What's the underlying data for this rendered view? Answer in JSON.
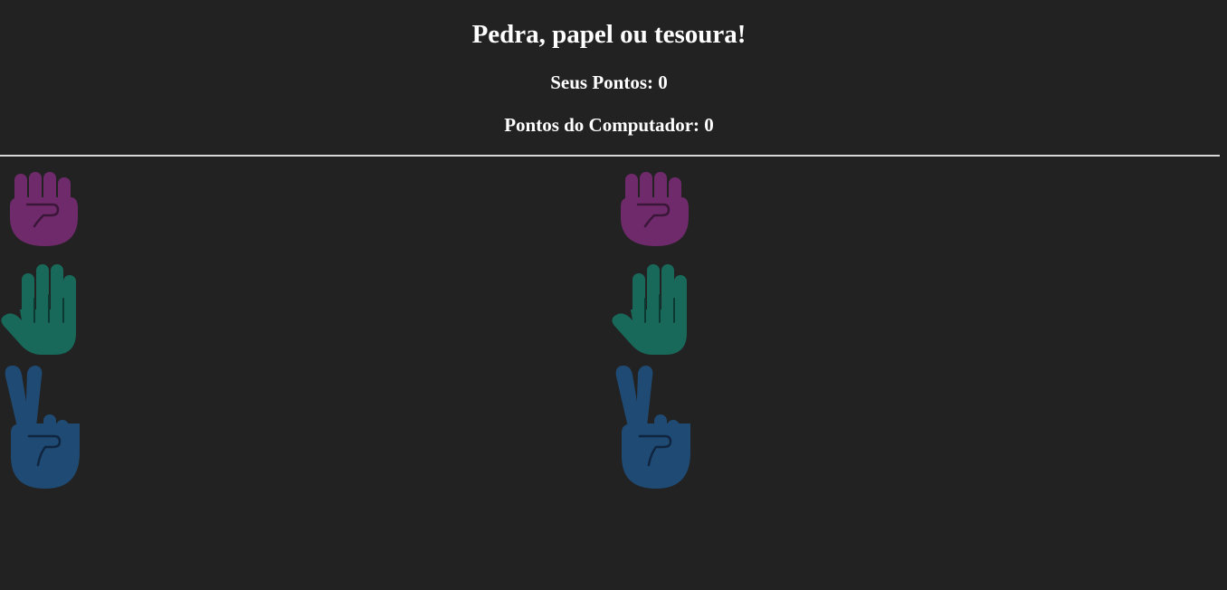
{
  "game": {
    "title": "Pedra, papel ou tesoura!",
    "player_score_label": "Seus Pontos: 0",
    "computer_score_label": "Pontos do Computador: 0"
  },
  "choices": [
    {
      "name": "rock",
      "icon": "fist-icon",
      "color": "#6f2a6b"
    },
    {
      "name": "paper",
      "icon": "open-hand-icon",
      "color": "#18695a"
    },
    {
      "name": "scissors",
      "icon": "victory-hand-icon",
      "color": "#1f4a73"
    }
  ]
}
